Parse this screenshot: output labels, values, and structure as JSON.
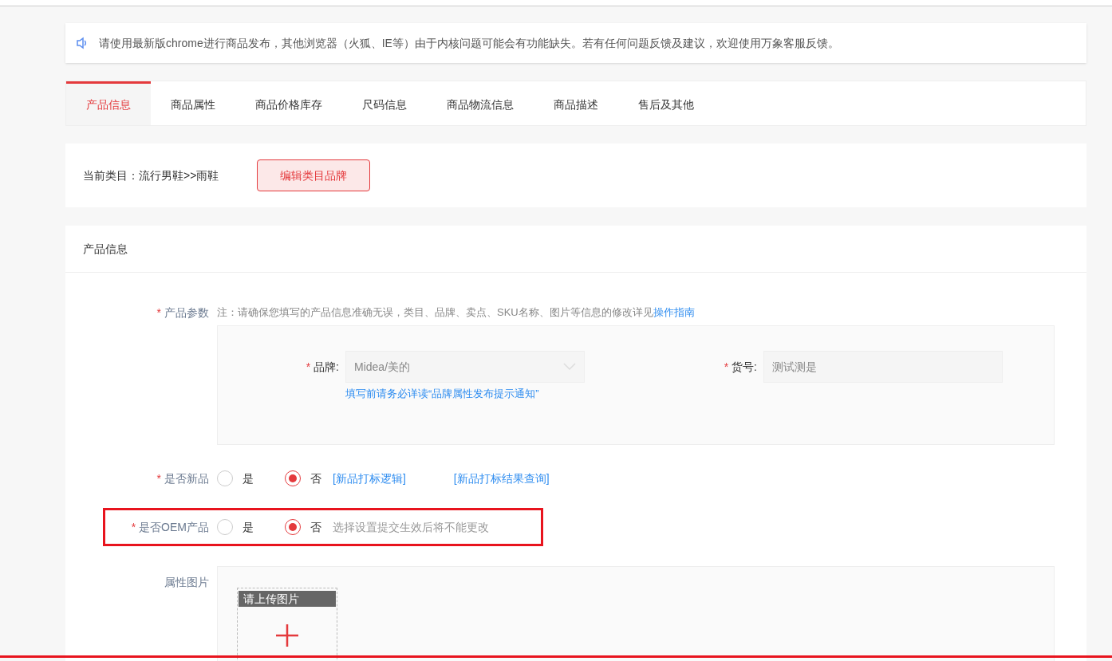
{
  "notice": {
    "text": "请使用最新版chrome进行商品发布，其他浏览器（火狐、IE等）由于内核问题可能会有功能缺失。若有任何问题反馈及建议，欢迎使用万象客服反馈。"
  },
  "tabs": [
    {
      "label": "产品信息",
      "selected": true
    },
    {
      "label": "商品属性",
      "selected": false
    },
    {
      "label": "商品价格库存",
      "selected": false
    },
    {
      "label": "尺码信息",
      "selected": false
    },
    {
      "label": "商品物流信息",
      "selected": false
    },
    {
      "label": "商品描述",
      "selected": false
    },
    {
      "label": "售后及其他",
      "selected": false
    }
  ],
  "category": {
    "text": "当前类目：流行男鞋>>雨鞋",
    "button": "编辑类目品牌"
  },
  "section": {
    "title": "产品信息",
    "params": {
      "label": "产品参数",
      "required_mark": "*",
      "note": "注：请确保您填写的产品信息准确无误，类目、品牌、卖点、SKU名称、图片等信息的修改详见",
      "link": "操作指南",
      "brand": {
        "label": "品牌:",
        "required_mark": "*",
        "value": "Midea/美的",
        "hint": "填写前请务必详读“品牌属性发布提示通知”"
      },
      "sku": {
        "label": "货号:",
        "required_mark": "*",
        "value": "测试测是"
      }
    },
    "new_product": {
      "label": "是否新品",
      "required_mark": "*",
      "highlighted": false,
      "options": [
        {
          "label": "是",
          "selected": false
        },
        {
          "label": "否",
          "selected": true
        }
      ],
      "links": [
        "[新品打标逻辑]",
        "[新品打标结果查询]"
      ]
    },
    "oem": {
      "label": "是否OEM产品",
      "required_mark": "*",
      "highlighted": true,
      "options": [
        {
          "label": "是",
          "selected": false
        },
        {
          "label": "否",
          "selected": true
        }
      ],
      "hint": "选择设置提交生效后将不能更改"
    },
    "images": {
      "label": "属性图片",
      "upload_label": "请上传图片"
    }
  }
}
